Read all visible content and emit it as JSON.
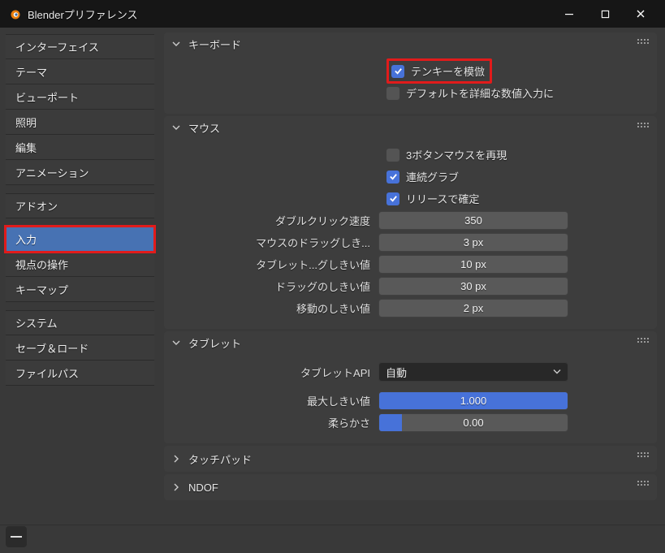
{
  "window": {
    "title": "Blenderプリファレンス"
  },
  "sidebar": {
    "groups": [
      [
        "インターフェイス",
        "テーマ",
        "ビューポート",
        "照明",
        "編集",
        "アニメーション"
      ],
      [
        "アドオン"
      ],
      [
        "入力",
        "視点の操作",
        "キーマップ"
      ],
      [
        "システム",
        "セーブ＆ロード",
        "ファイルパス"
      ]
    ],
    "active": "入力",
    "highlighted": "入力"
  },
  "panels": {
    "keyboard": {
      "title": "キーボード",
      "emulate_numpad": {
        "label": "テンキーを模倣",
        "checked": true,
        "highlight": true
      },
      "default_numeric": {
        "label": "デフォルトを詳細な数値入力に",
        "checked": false
      }
    },
    "mouse": {
      "title": "マウス",
      "emulate_3button": {
        "label": "3ボタンマウスを再現",
        "checked": false
      },
      "continuous_grab": {
        "label": "連続グラブ",
        "checked": true
      },
      "release_confirm": {
        "label": "リリースで確定",
        "checked": true
      },
      "double_click": {
        "label": "ダブルクリック速度",
        "value": "350"
      },
      "mouse_drag": {
        "label": "マウスのドラッグしき...",
        "value": "3 px"
      },
      "tablet_drag": {
        "label": "タブレット...グしきい値",
        "value": "10 px"
      },
      "drag_threshold": {
        "label": "ドラッグのしきい値",
        "value": "30 px"
      },
      "move_threshold": {
        "label": "移動のしきい値",
        "value": "2 px"
      }
    },
    "tablet": {
      "title": "タブレット",
      "api": {
        "label": "タブレットAPI",
        "value": "自動"
      },
      "max_threshold": {
        "label": "最大しきい値",
        "value": "1.000",
        "fill_pct": 100
      },
      "softness": {
        "label": "柔らかさ",
        "value": "0.00",
        "fill_pct": 12
      }
    },
    "touchpad": {
      "title": "タッチパッド"
    },
    "ndof": {
      "title": "NDOF"
    }
  }
}
